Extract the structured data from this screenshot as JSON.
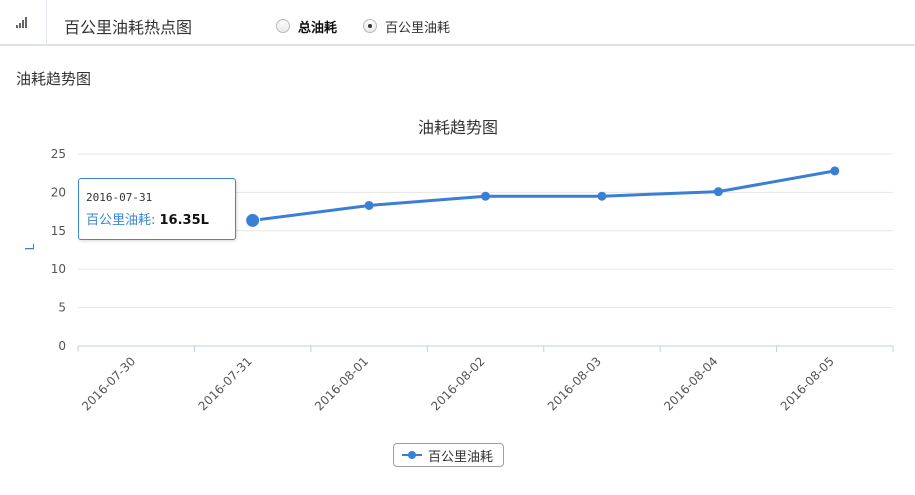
{
  "header": {
    "icon": "signal-bars-icon",
    "title": "百公里油耗热点图",
    "radios": [
      {
        "label": "总油耗",
        "checked": false
      },
      {
        "label": "百公里油耗",
        "checked": true
      }
    ]
  },
  "section": {
    "title": "油耗趋势图"
  },
  "tooltip": {
    "date": "2016-07-31",
    "series_label": "百公里油耗: ",
    "value": "16.35L"
  },
  "legend": {
    "label": "百公里油耗"
  },
  "colors": {
    "series": "#3a7fd6",
    "grid": "#e6e6e6",
    "axis": "#c0d0e0"
  },
  "chart_data": {
    "type": "line",
    "title": "油耗趋势图",
    "ylabel": "L",
    "xlabel": "",
    "categories": [
      "2016-07-30",
      "2016-07-31",
      "2016-08-01",
      "2016-08-02",
      "2016-08-03",
      "2016-08-04",
      "2016-08-05"
    ],
    "series": [
      {
        "name": "百公里油耗",
        "values": [
          null,
          16.35,
          18.3,
          19.5,
          19.5,
          20.1,
          22.8
        ]
      }
    ],
    "ylim": [
      0,
      25
    ],
    "yticks": [
      0,
      5,
      10,
      15,
      20,
      25
    ],
    "grid": true,
    "legend_position": "bottom-center"
  }
}
